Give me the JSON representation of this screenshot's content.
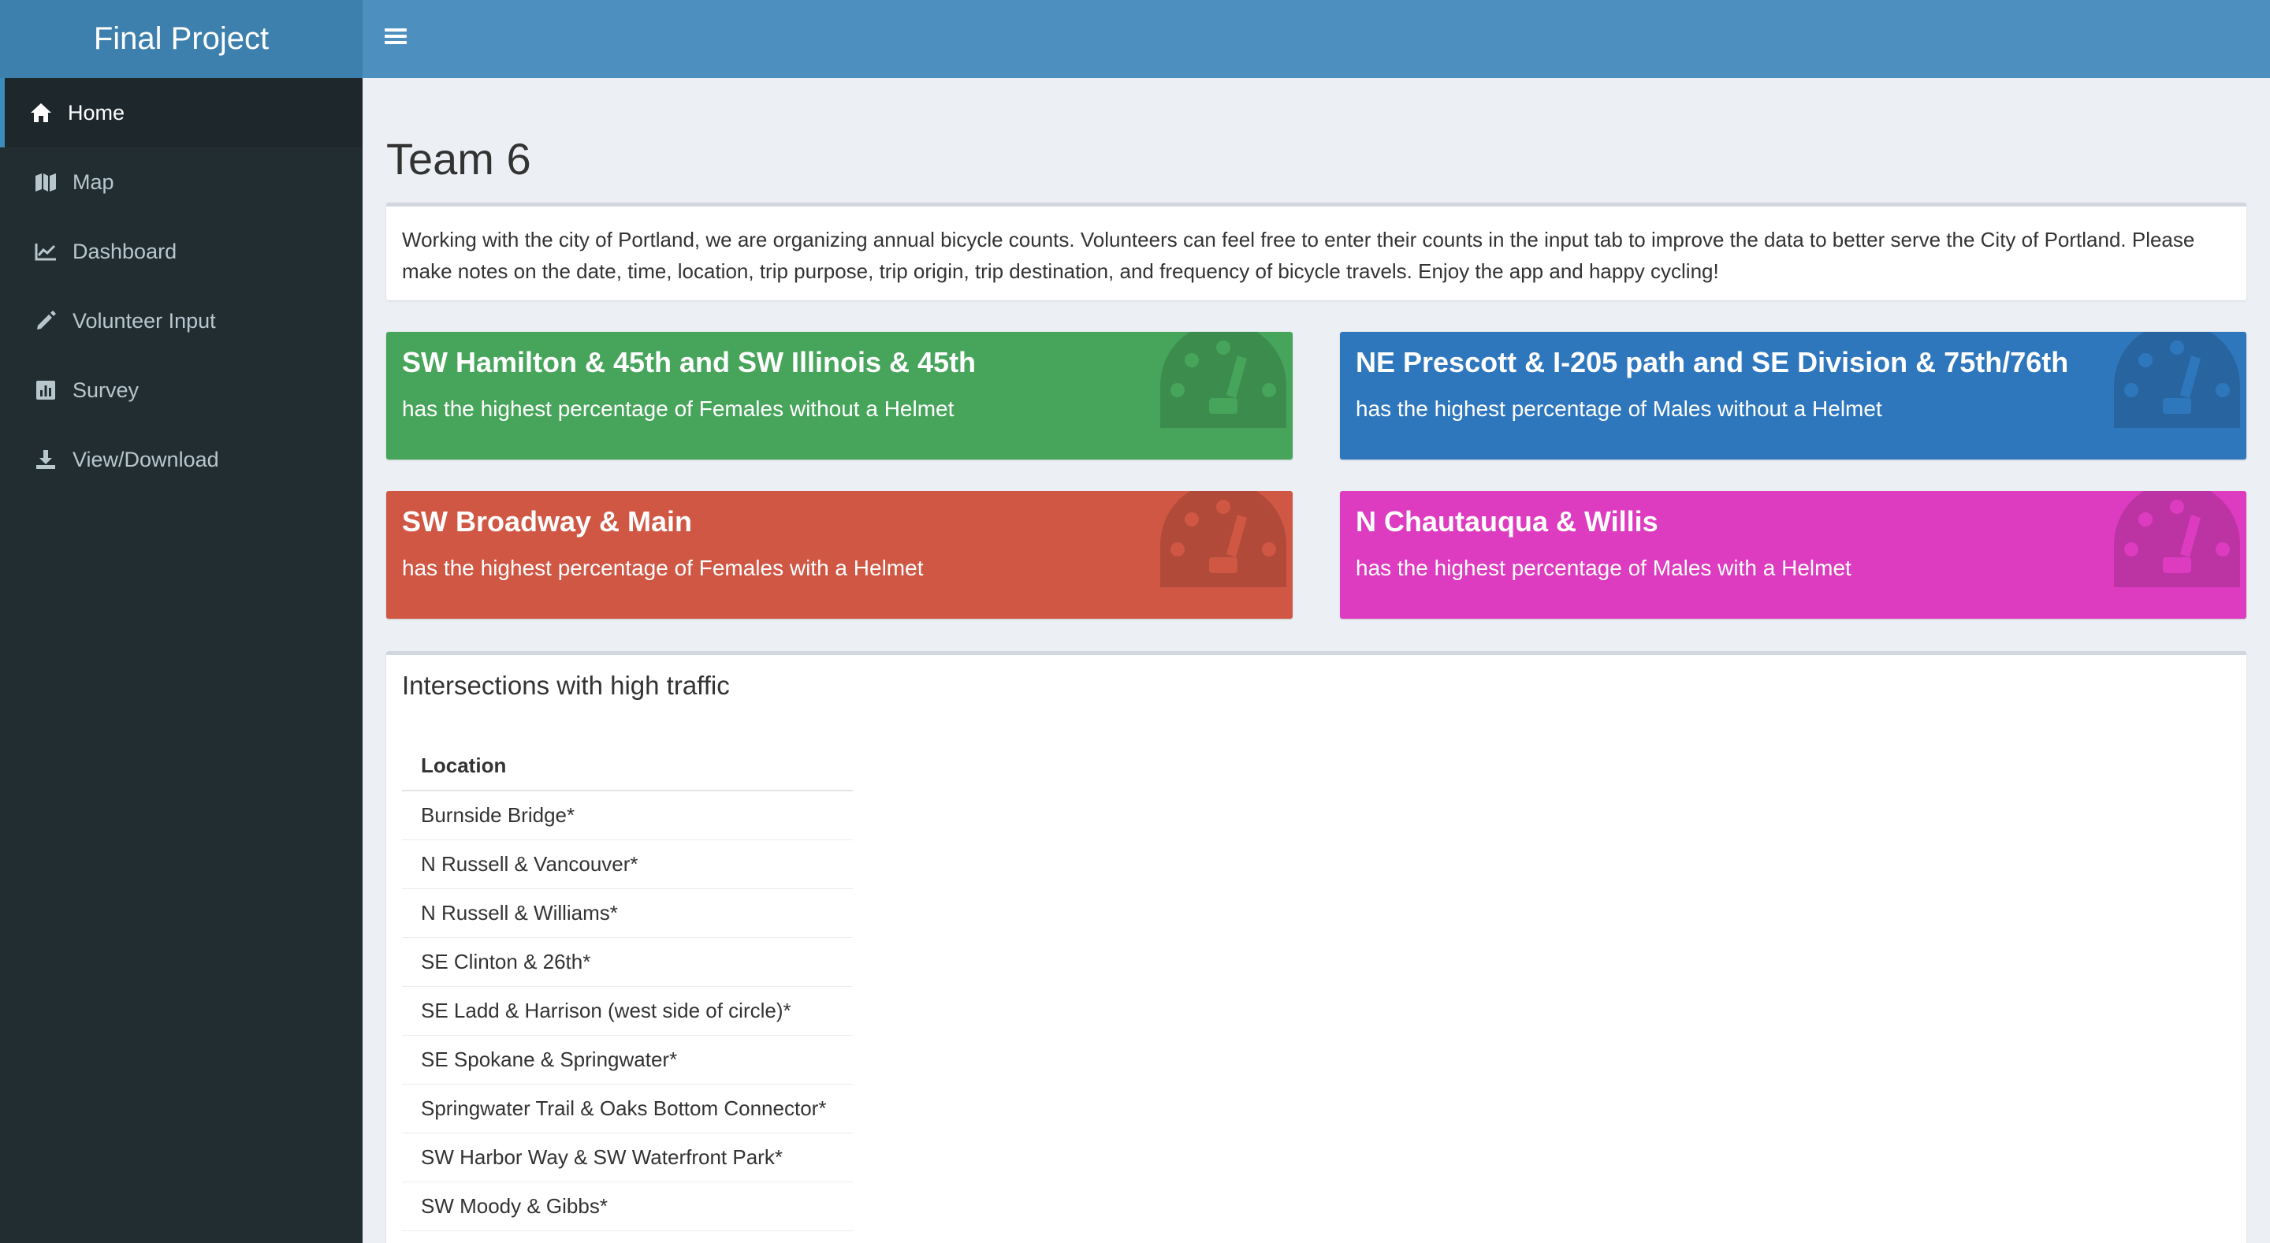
{
  "header": {
    "brand": "Final Project",
    "menu_icon": "hamburger-icon"
  },
  "sidebar": {
    "items": [
      {
        "label": "Home",
        "icon": "home-icon",
        "active": true
      },
      {
        "label": "Map",
        "icon": "map-icon"
      },
      {
        "label": "Dashboard",
        "icon": "line-chart-icon"
      },
      {
        "label": "Volunteer Input",
        "icon": "pencil-icon"
      },
      {
        "label": "Survey",
        "icon": "bar-chart-icon"
      },
      {
        "label": "View/Download",
        "icon": "download-icon"
      }
    ]
  },
  "main": {
    "title": "Team 6",
    "intro": "Working with the city of Portland, we are organizing annual bicycle counts. Volunteers can feel free to enter their counts in the input tab to improve the data to better serve the City of Portland. Please make notes on the date, time, location, trip purpose, trip origin, trip destination, and frequency of bicycle travels. Enjoy the app and happy cycling!",
    "value_boxes": [
      {
        "title": "SW Hamilton & 45th and SW Illinois & 45th",
        "subtitle": "has the highest percentage of Females without a Helmet",
        "color": "#47a55b"
      },
      {
        "title": "NE Prescott & I-205 path and SE Division & 75th/76th",
        "subtitle": "has the highest percentage of Males without a Helmet",
        "color": "#2f77bd"
      },
      {
        "title": "SW Broadway & Main",
        "subtitle": "has the highest percentage of Females with a Helmet",
        "color": "#d05744"
      },
      {
        "title": "N Chautauqua & Willis",
        "subtitle": "has the highest percentage of Males with a Helmet",
        "color": "#dd3cc0"
      }
    ],
    "table_box": {
      "title": "Intersections with high traffic",
      "column": "Location",
      "rows": [
        "Burnside Bridge*",
        "N Russell & Vancouver*",
        "N Russell & Williams*",
        "SE Clinton & 26th*",
        "SE Ladd & Harrison (west side of circle)*",
        "SE Spokane & Springwater*",
        "Springwater Trail & Oaks Bottom Connector*",
        "SW Harbor Way & SW Waterfront Park*",
        "SW Moody & Gibbs*"
      ]
    }
  }
}
